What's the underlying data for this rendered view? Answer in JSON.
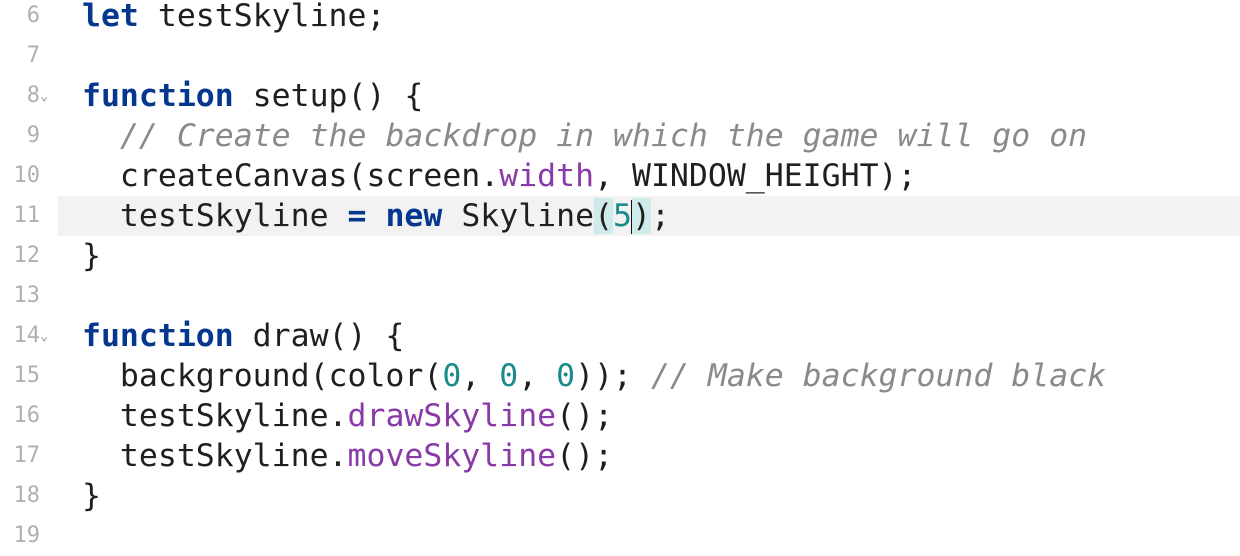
{
  "editor": {
    "lines": [
      {
        "num": "6",
        "fold": ""
      },
      {
        "num": "7",
        "fold": ""
      },
      {
        "num": "8",
        "fold": "⌄"
      },
      {
        "num": "9",
        "fold": ""
      },
      {
        "num": "10",
        "fold": ""
      },
      {
        "num": "11",
        "fold": ""
      },
      {
        "num": "12",
        "fold": ""
      },
      {
        "num": "13",
        "fold": ""
      },
      {
        "num": "14",
        "fold": "⌄"
      },
      {
        "num": "15",
        "fold": ""
      },
      {
        "num": "16",
        "fold": ""
      },
      {
        "num": "17",
        "fold": ""
      },
      {
        "num": "18",
        "fold": ""
      },
      {
        "num": "19",
        "fold": ""
      }
    ],
    "active_line": "11",
    "tokens": {
      "l6_kw": "let",
      "l6_rest": " testSkyline;",
      "l8_kw": "function",
      "l8_rest": " setup() {",
      "l9_indent": "  ",
      "l9_comment": "// Create the backdrop in which the game will go on",
      "l10_a": "  createCanvas(screen.",
      "l10_prop": "width",
      "l10_b": ", WINDOW_HEIGHT);",
      "l11_a": "  testSkyline ",
      "l11_op": "=",
      "l11_sp": " ",
      "l11_kw": "new",
      "l11_b": " Skyline",
      "l11_open": "(",
      "l11_num": "5",
      "l11_close": ")",
      "l11_end": ";",
      "l12": "}",
      "l14_kw": "function",
      "l14_rest": " draw() {",
      "l15_a": "  background(color(",
      "l15_n1": "0",
      "l15_c1": ", ",
      "l15_n2": "0",
      "l15_c2": ", ",
      "l15_n3": "0",
      "l15_b": ")); ",
      "l15_comment": "// Make background black",
      "l16_a": "  testSkyline.",
      "l16_prop": "drawSkyline",
      "l16_b": "();",
      "l17_a": "  testSkyline.",
      "l17_prop": "moveSkyline",
      "l17_b": "();",
      "l18": "}"
    }
  },
  "colors": {
    "keyword": "#06378f",
    "property": "#8a3aa8",
    "number": "#1a8a8a",
    "comment": "#8a8a8a",
    "active_line_bg": "#f2f2f2",
    "bracket_match_bg": "#cfeaea"
  }
}
